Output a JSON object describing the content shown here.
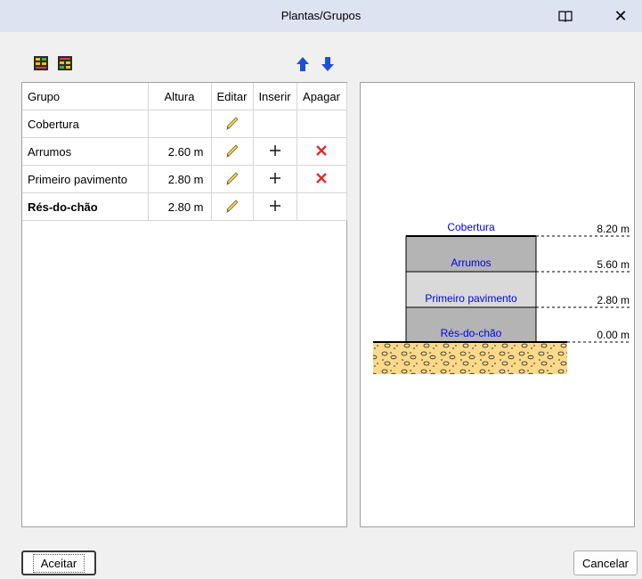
{
  "window": {
    "title": "Plantas/Grupos"
  },
  "titlebar_icons": {
    "help": "book-icon",
    "close": "close-icon",
    "close_glyph": "✕"
  },
  "toolbar_icons": [
    "add-floor-above-icon",
    "add-floor-below-icon",
    "move-up-arrow-icon",
    "move-down-arrow-icon"
  ],
  "table": {
    "headers": [
      "Grupo",
      "Altura",
      "Editar",
      "Inserir",
      "Apagar"
    ],
    "rows": [
      {
        "grupo": "Cobertura",
        "altura": "",
        "bold": false,
        "editar": true,
        "inserir": false,
        "apagar": false
      },
      {
        "grupo": "Arrumos",
        "altura": "2.60 m",
        "bold": false,
        "editar": true,
        "inserir": true,
        "apagar": true
      },
      {
        "grupo": "Primeiro pavimento",
        "altura": "2.80 m",
        "bold": false,
        "editar": true,
        "inserir": true,
        "apagar": true
      },
      {
        "grupo": "Rés-do-chão",
        "altura": "2.80 m",
        "bold": true,
        "editar": true,
        "inserir": true,
        "apagar": false
      }
    ],
    "insert_glyph": "+",
    "delete_glyph": "✕"
  },
  "diagram": {
    "levels": [
      {
        "name": "Cobertura",
        "elevation": "8.20 m"
      },
      {
        "name": "Arrumos",
        "elevation": "5.60 m"
      },
      {
        "name": "Primeiro pavimento",
        "elevation": "2.80 m"
      },
      {
        "name": "Rés-do-chão",
        "elevation": "0.00 m"
      }
    ]
  },
  "buttons": {
    "ok": "Aceitar",
    "cancel": "Cancelar"
  },
  "colors": {
    "titlebar": "#dde3f1",
    "level_label": "#0000ee",
    "arrow": "#1f4fd8",
    "delete": "#d9302b",
    "ground": "#fbd98a",
    "floor_dark": "#b4b4b4",
    "floor_light": "#d9d9d9"
  }
}
